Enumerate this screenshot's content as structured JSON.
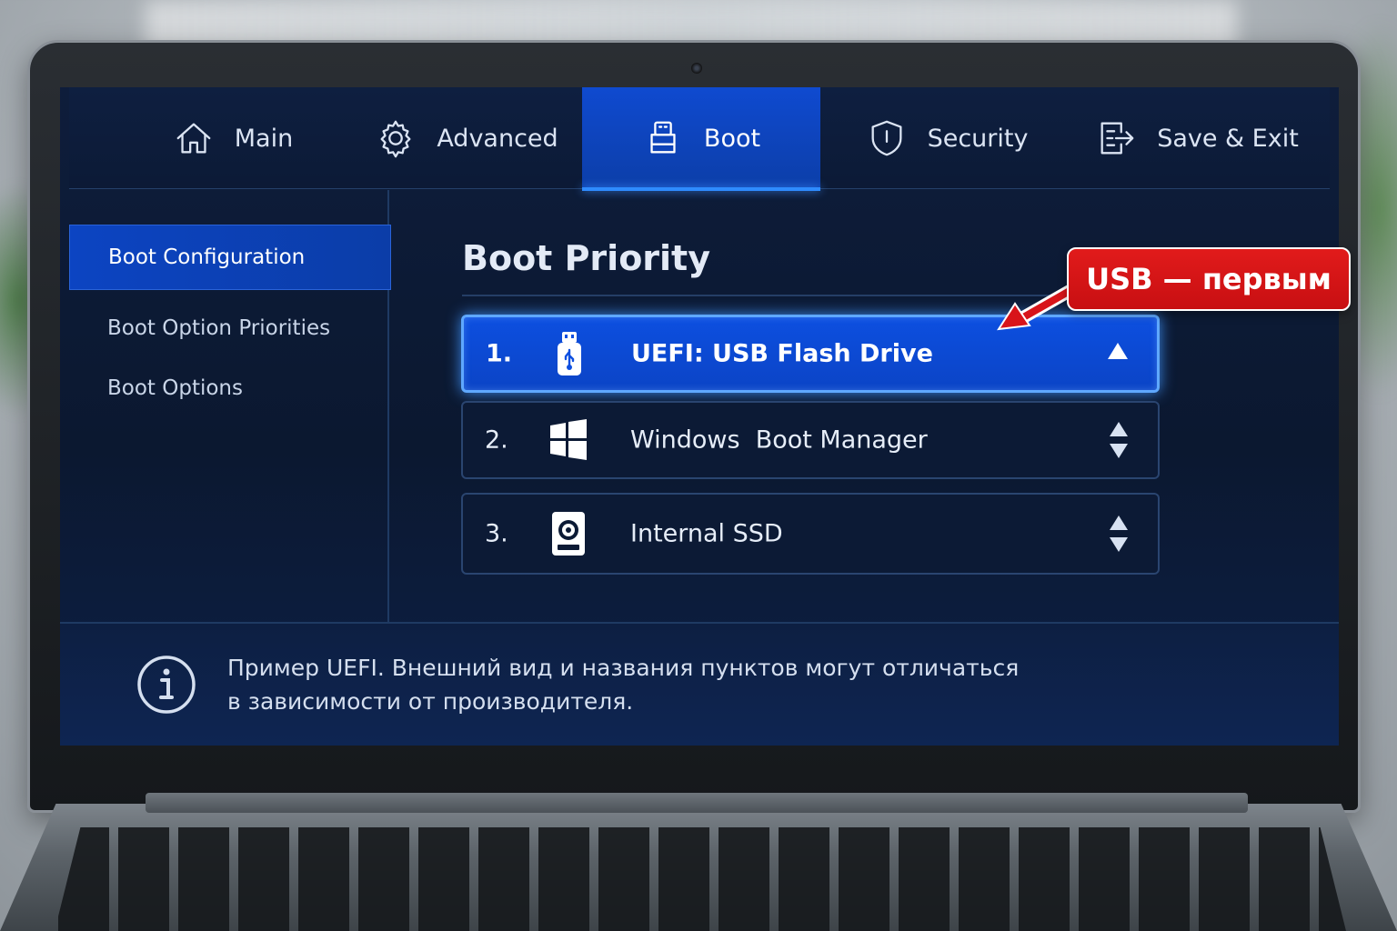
{
  "tabs": [
    {
      "id": "main",
      "label": "Main",
      "icon": "home-icon"
    },
    {
      "id": "advanced",
      "label": "Advanced",
      "icon": "gear-icon"
    },
    {
      "id": "boot",
      "label": "Boot",
      "icon": "usb-drive-icon",
      "active": true
    },
    {
      "id": "security",
      "label": "Security",
      "icon": "shield-icon"
    },
    {
      "id": "save_exit",
      "label": "Save & Exit",
      "icon": "exit-icon"
    }
  ],
  "sidebar": {
    "items": [
      {
        "label": "Boot Configuration",
        "active": true
      },
      {
        "label": "Boot Option Priorities"
      },
      {
        "label": "Boot Options"
      }
    ]
  },
  "main": {
    "title": "Boot Priority",
    "boot_list": [
      {
        "num": "1.",
        "label": "UEFI: USB Flash Drive",
        "icon": "usb-flash-icon",
        "selected": true,
        "arrows": "up-only"
      },
      {
        "num": "2.",
        "label": "Windows  Boot Manager",
        "icon": "windows-logo-icon",
        "arrows": "up-down"
      },
      {
        "num": "3.",
        "label": "Internal SSD",
        "icon": "drive-icon",
        "arrows": "up-down"
      }
    ]
  },
  "footer": {
    "line1": "Пример UEFI. Внешний вид и названия пунктов могут отличаться",
    "line2": "в зависимости от производителя."
  },
  "callout": {
    "text": "USB — первым"
  },
  "colors": {
    "accent": "#0c44c2",
    "callout": "#d8141a",
    "screen_bg": "#0c1a36"
  }
}
